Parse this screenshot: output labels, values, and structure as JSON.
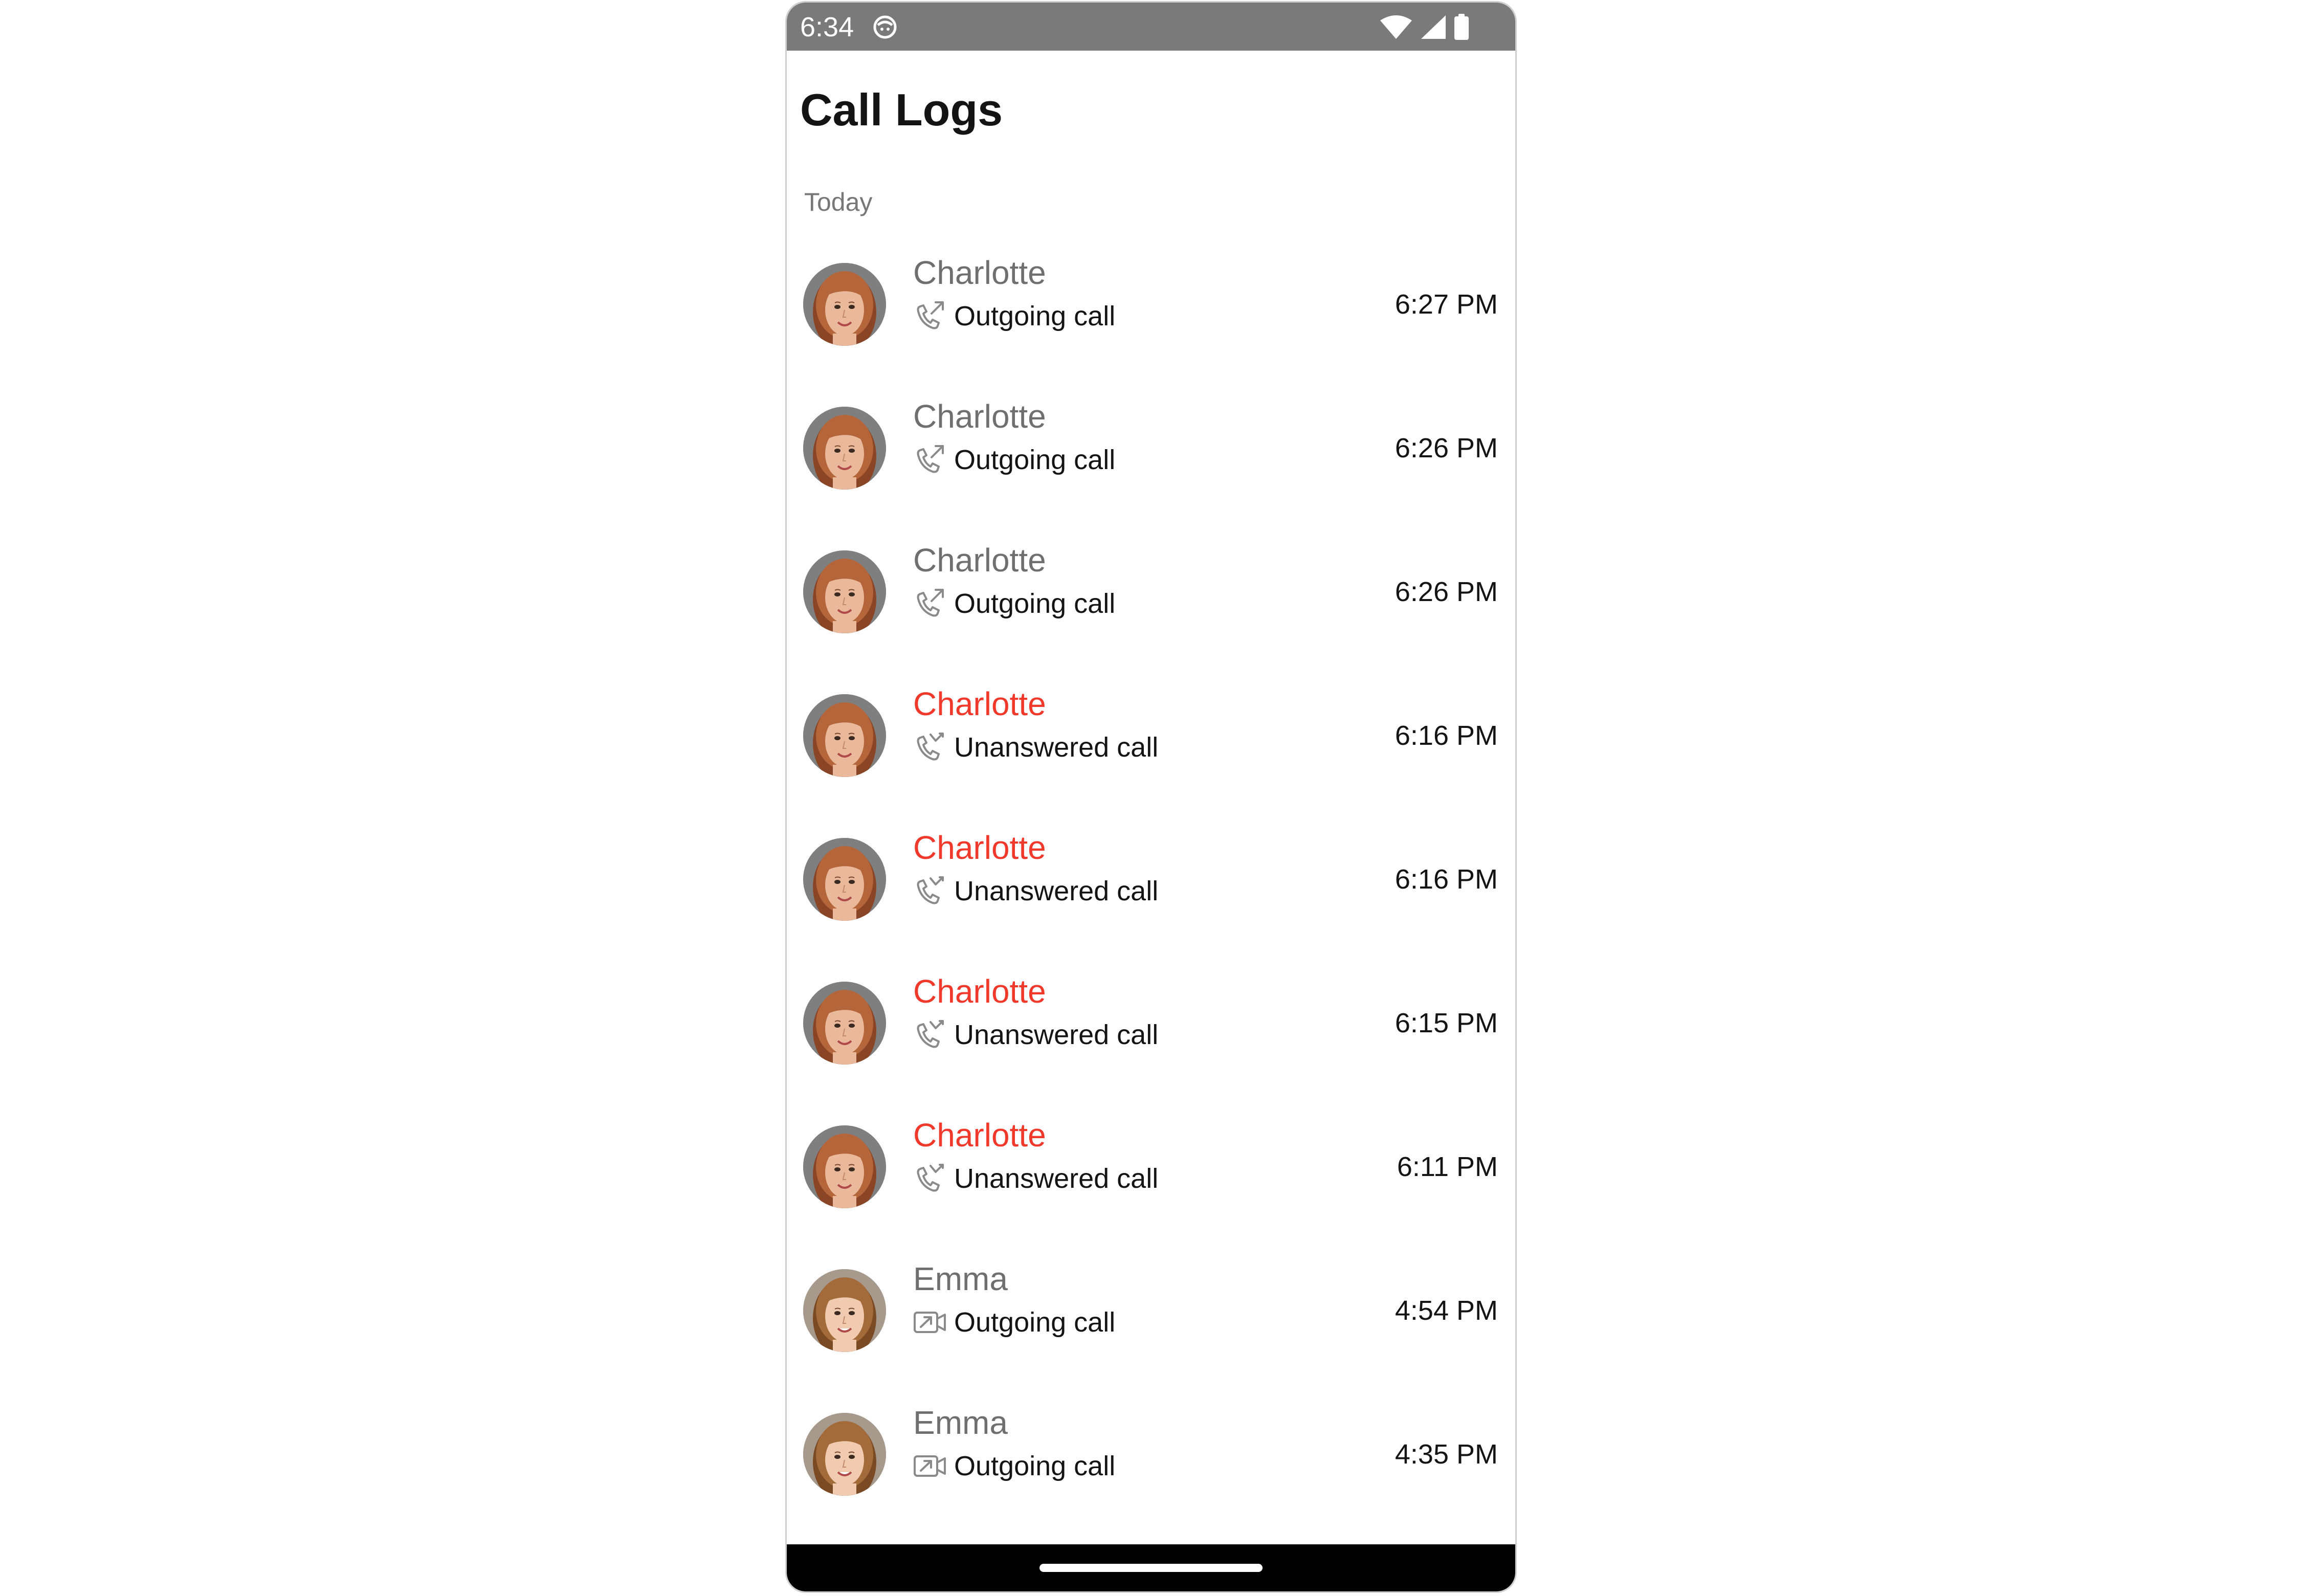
{
  "status_bar": {
    "time": "6:34",
    "app_icon": "notification-app-icon",
    "icons": [
      "wifi-icon",
      "signal-icon",
      "battery-icon"
    ]
  },
  "title": "Call Logs",
  "section": "Today",
  "colors": {
    "status_bar": "#7a7a7a",
    "missed_name": "#f0392b",
    "normal_name": "#6f6f6f",
    "text": "#141414",
    "muted": "#777777"
  },
  "calls": [
    {
      "name": "Charlotte",
      "type": "Outgoing call",
      "time": "6:27 PM",
      "icon": "outgoing-call-icon",
      "missed": false,
      "avatar": "charlotte"
    },
    {
      "name": "Charlotte",
      "type": "Outgoing call",
      "time": "6:26 PM",
      "icon": "outgoing-call-icon",
      "missed": false,
      "avatar": "charlotte"
    },
    {
      "name": "Charlotte",
      "type": "Outgoing call",
      "time": "6:26 PM",
      "icon": "outgoing-call-icon",
      "missed": false,
      "avatar": "charlotte"
    },
    {
      "name": "Charlotte",
      "type": "Unanswered call",
      "time": "6:16 PM",
      "icon": "missed-call-icon",
      "missed": true,
      "avatar": "charlotte"
    },
    {
      "name": "Charlotte",
      "type": "Unanswered call",
      "time": "6:16 PM",
      "icon": "missed-call-icon",
      "missed": true,
      "avatar": "charlotte"
    },
    {
      "name": "Charlotte",
      "type": "Unanswered call",
      "time": "6:15 PM",
      "icon": "missed-call-icon",
      "missed": true,
      "avatar": "charlotte"
    },
    {
      "name": "Charlotte",
      "type": "Unanswered call",
      "time": "6:11 PM",
      "icon": "missed-call-icon",
      "missed": true,
      "avatar": "charlotte"
    },
    {
      "name": "Emma",
      "type": "Outgoing call",
      "time": "4:54 PM",
      "icon": "outgoing-video-call-icon",
      "missed": false,
      "avatar": "emma"
    },
    {
      "name": "Emma",
      "type": "Outgoing call",
      "time": "4:35 PM",
      "icon": "outgoing-video-call-icon",
      "missed": false,
      "avatar": "emma"
    }
  ]
}
